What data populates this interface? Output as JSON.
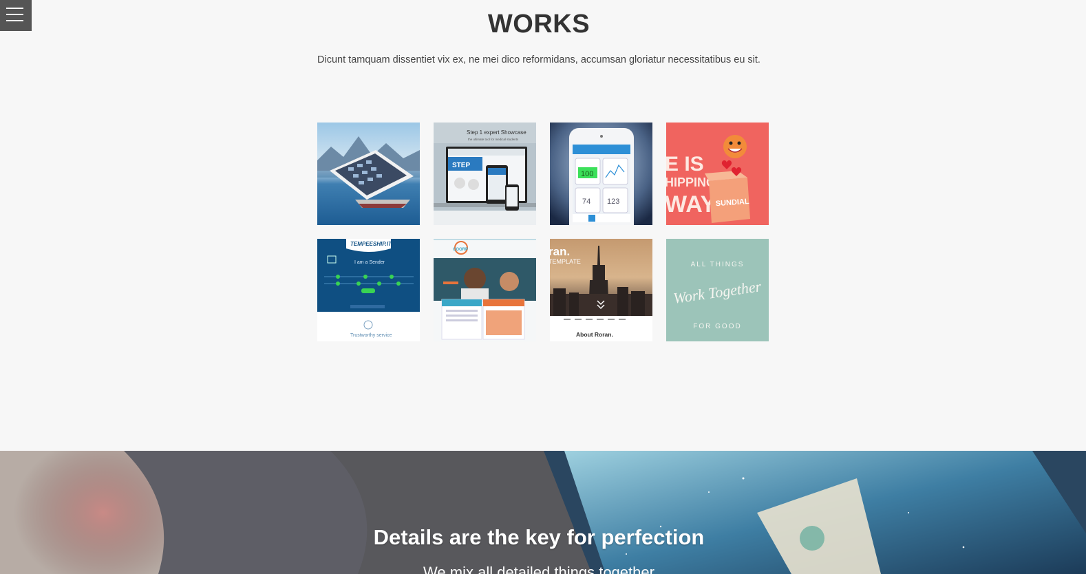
{
  "nav": {
    "menu_icon": "hamburger-icon"
  },
  "works": {
    "title": "WORKS",
    "subtitle": "Dicunt tamquam dissentiet vix ex, ne mei dico reformidans, accumsan gloriatur necessitatibus eu sit."
  },
  "tiles": {
    "t2_heading": "Step 1 expert Showcase",
    "t2_sub": "the ultimate tool for medical students",
    "t3_value1": "100",
    "t3_value2": "74",
    "t3_value3": "123",
    "t4_text1": "E IS",
    "t4_text2": "HIPPING",
    "t4_text3": "WAY",
    "t4_brand": "SUNDIAL",
    "t5_brand": "TEMPEESHIP.IT",
    "t5_line": "I am a Sender",
    "t5_footer": "Trustworthy service",
    "t6_brand": "COORP",
    "t7_title": "ran.",
    "t7_sub": "TEMPLATE",
    "t7_about": "About Roran.",
    "t8_line1": "ALL THINGS",
    "t8_line2": "Work Together",
    "t8_line3": "FOR GOOD"
  },
  "hero": {
    "title": "Details are the key for perfection",
    "subtitle": "We mix all detailed things together"
  }
}
